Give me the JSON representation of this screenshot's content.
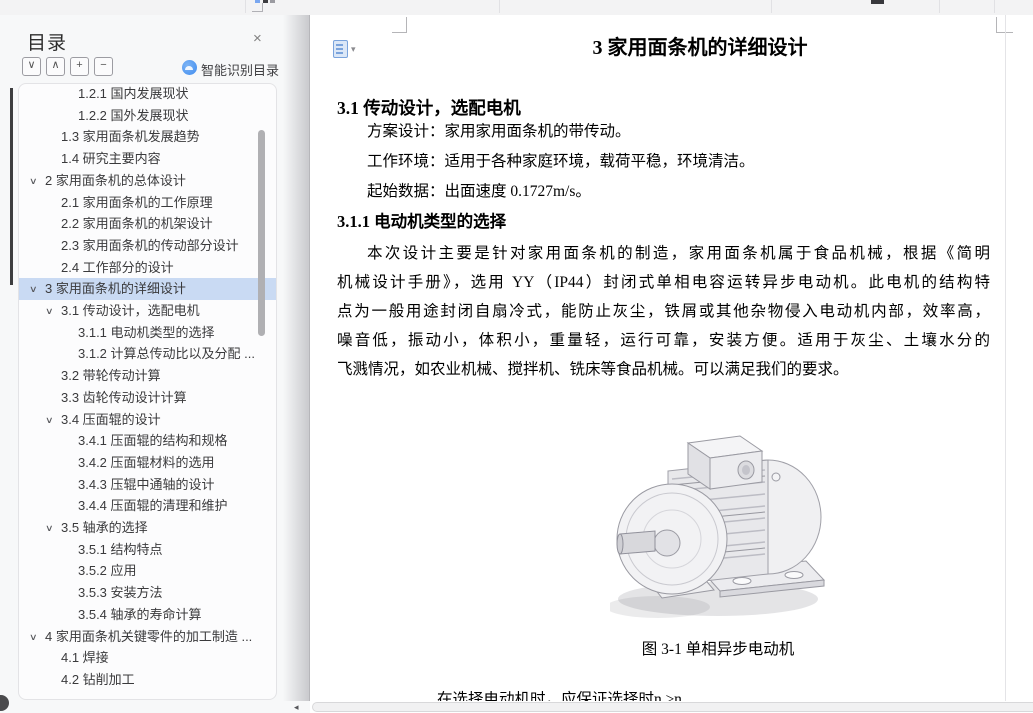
{
  "topbar": {
    "note": "clipped toolbar remnants",
    "icons": [
      "blue-pixel-icon",
      "dark-pixel-icon",
      "gray-pixel-icon",
      "dark-toolbar-icon",
      "corner-mark"
    ]
  },
  "sidebar": {
    "title": "目录",
    "close_glyph": "×",
    "toolbar": {
      "expand_all_glyph": "∨",
      "collapse_all_glyph": "∧",
      "plus_glyph": "+",
      "minus_glyph": "−",
      "ai_label": "智能识别目录",
      "ai_icon": "cloud-ai-icon"
    },
    "toc": [
      {
        "label": "1.2.1 国内发展现状",
        "level": 3
      },
      {
        "label": "1.2.2 国外发展现状",
        "level": 3
      },
      {
        "label": "1.3 家用面条机发展趋势",
        "level": 2
      },
      {
        "label": "1.4 研究主要内容",
        "level": 2
      },
      {
        "label": "2 家用面条机的总体设计",
        "level": 1,
        "arrow": true
      },
      {
        "label": "2.1 家用面条机的工作原理",
        "level": 2
      },
      {
        "label": "2.2 家用面条机的机架设计",
        "level": 2
      },
      {
        "label": "2.3 家用面条机的传动部分设计",
        "level": 2
      },
      {
        "label": "2.4 工作部分的设计",
        "level": 2
      },
      {
        "label": "3 家用面条机的详细设计",
        "level": 1,
        "arrow": true,
        "selected": true
      },
      {
        "label": "3.1 传动设计，选配电机",
        "level": 2,
        "arrow": true
      },
      {
        "label": "3.1.1 电动机类型的选择",
        "level": 3
      },
      {
        "label": "3.1.2 计算总传动比以及分配 ...",
        "level": 3
      },
      {
        "label": "3.2 带轮传动计算",
        "level": 2
      },
      {
        "label": "3.3 齿轮传动设计计算",
        "level": 2
      },
      {
        "label": "3.4 压面辊的设计",
        "level": 2,
        "arrow": true
      },
      {
        "label": "3.4.1 压面辊的结构和规格",
        "level": 3
      },
      {
        "label": "3.4.2 压面辊材料的选用",
        "level": 3
      },
      {
        "label": "3.4.3 压辊中通轴的设计",
        "level": 3
      },
      {
        "label": "3.4.4 压面辊的清理和维护",
        "level": 3
      },
      {
        "label": "3.5 轴承的选择",
        "level": 2,
        "arrow": true
      },
      {
        "label": "3.5.1 结构特点",
        "level": 3
      },
      {
        "label": "3.5.2 应用",
        "level": 3
      },
      {
        "label": "3.5.3 安装方法",
        "level": 3
      },
      {
        "label": "3.5.4 轴承的寿命计算",
        "level": 3
      },
      {
        "label": "4 家用面条机关键零件的加工制造 ...",
        "level": 1,
        "arrow": true
      },
      {
        "label": "4.1 焊接",
        "level": 2
      },
      {
        "label": "4.2 钻削加工",
        "level": 2
      }
    ],
    "chevron_glyph": "∨"
  },
  "document": {
    "title": "3 家用面条机的详细设计",
    "heading1": "3.1 传动设计，选配电机",
    "intro_lines": [
      "方案设计：家用家用面条机的带传动。",
      "工作环境：适用于各种家庭环境，载荷平稳，环境清洁。",
      "起始数据：出面速度 0.1727m/s。"
    ],
    "heading2": "3.1.1 电动机类型的选择",
    "body_lines": [
      "本次设计主要是针对家用面条机的制造，家用面条机属于食品机械，根据《简明",
      "机械设计手册》，选用 YY（IP44）封闭式单相电容运转异步电动机。此电机的结构特",
      "点为一般用途封闭自扇冷式，能防止灰尘，铁屑或其他杂物侵入电动机内部，效率高，",
      "噪音低，振动小，体积小，重量轻，运行可靠，安装方便。适用于灰尘、土壤水分的",
      "飞溅情况，如农业机械、搅拌机、铣床等食品机械。可以满足我们的要求。"
    ],
    "figure": {
      "caption": "图 3-1 单相异步电动机",
      "image": "single-phase-asynchronous-motor-3d-render"
    },
    "clipped_line": "在选择电动机时，应保证选择时n ≥n",
    "doc_badge_icon": "annotation-document-icon",
    "caret_glyph": "▾"
  },
  "bottombar": {
    "left_arrow_glyph": "◂"
  },
  "colors": {
    "selection_blue": "#c9daf3",
    "ai_icon_blue": "#3f8cef",
    "badge_blue": "#7aa3dc",
    "sidebar_bg": "#f7f8f9",
    "topbar_bg": "#f3f3f4",
    "indicator_dark": "#3d3d3f"
  }
}
